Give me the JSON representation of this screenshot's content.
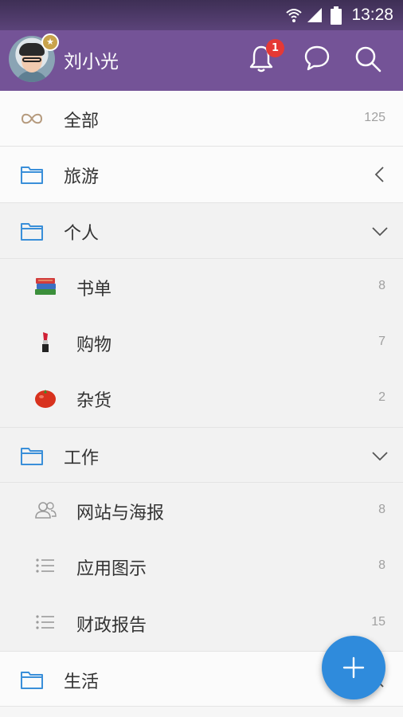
{
  "status_bar": {
    "time": "13:28"
  },
  "header": {
    "username": "刘小光",
    "notification_count": "1"
  },
  "icons": {
    "wifi": "wifi-icon",
    "signal": "signal-icon",
    "battery": "battery-icon",
    "bell": "bell-icon",
    "chat": "chat-icon",
    "search": "search-icon",
    "add": "plus-icon"
  },
  "colors": {
    "header": "#745397",
    "folder": "#3a8fd9",
    "fab": "#2f8bdc",
    "badge": "#e53935"
  },
  "lists": [
    {
      "label": "全部",
      "count": "125"
    },
    {
      "label": "旅游"
    },
    {
      "label": "个人"
    },
    {
      "label": "书单",
      "count": "8"
    },
    {
      "label": "购物",
      "count": "7"
    },
    {
      "label": "杂货",
      "count": "2"
    },
    {
      "label": "工作"
    },
    {
      "label": "网站与海报",
      "count": "8"
    },
    {
      "label": "应用图示",
      "count": "8"
    },
    {
      "label": "财政报告",
      "count": "15"
    },
    {
      "label": "生活"
    }
  ]
}
